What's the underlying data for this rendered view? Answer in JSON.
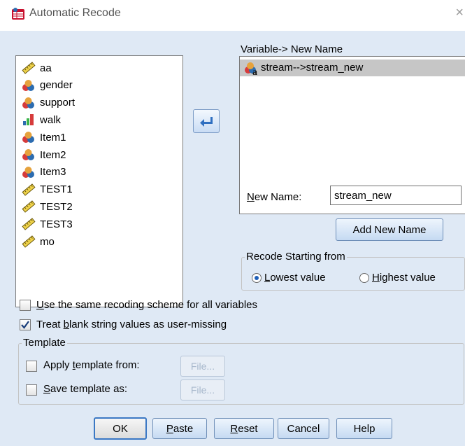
{
  "window": {
    "title": "Automatic Recode",
    "close_glyph": "×"
  },
  "source_variables": [
    {
      "name": "aa",
      "icon": "scale-ruler-icon"
    },
    {
      "name": "gender",
      "icon": "nominal-icon"
    },
    {
      "name": "support",
      "icon": "nominal-icon"
    },
    {
      "name": "walk",
      "icon": "ordinal-bar-icon"
    },
    {
      "name": "Item1",
      "icon": "nominal-icon"
    },
    {
      "name": "Item2",
      "icon": "nominal-icon"
    },
    {
      "name": "Item3",
      "icon": "nominal-icon"
    },
    {
      "name": "TEST1",
      "icon": "scale-ruler-icon"
    },
    {
      "name": "TEST2",
      "icon": "scale-ruler-icon"
    },
    {
      "name": "TEST3",
      "icon": "scale-ruler-icon"
    },
    {
      "name": "mo",
      "icon": "scale-ruler-icon"
    }
  ],
  "target": {
    "label": "Variable-> New Name",
    "items": [
      {
        "text": "stream-->stream_new",
        "icon": "nominal-string-icon",
        "selected": true
      }
    ]
  },
  "new_name": {
    "label": "New Name:",
    "value": "stream_new",
    "button": "Add New Name"
  },
  "recode_start": {
    "legend": "Recode Starting from",
    "lowest": {
      "label": "Lowest value",
      "selected": true
    },
    "highest": {
      "label": "Highest value",
      "selected": false
    }
  },
  "options": {
    "same_scheme": {
      "label": "Use the same recoding scheme for all variables",
      "checked": false
    },
    "blank_missing": {
      "label": "Treat blank string values as user-missing",
      "checked": true
    }
  },
  "template": {
    "legend": "Template",
    "apply": {
      "label": "Apply template from:",
      "checked": false,
      "button": "File..."
    },
    "save": {
      "label": "Save template as:",
      "checked": false,
      "button": "File..."
    }
  },
  "buttons": {
    "ok": "OK",
    "paste": "Paste",
    "reset": "Reset",
    "cancel": "Cancel",
    "help": "Help"
  },
  "colors": {
    "dialog_bg": "#dfe9f5",
    "selected_row": "#c6c6c6",
    "focus_border": "#3b78c4"
  }
}
